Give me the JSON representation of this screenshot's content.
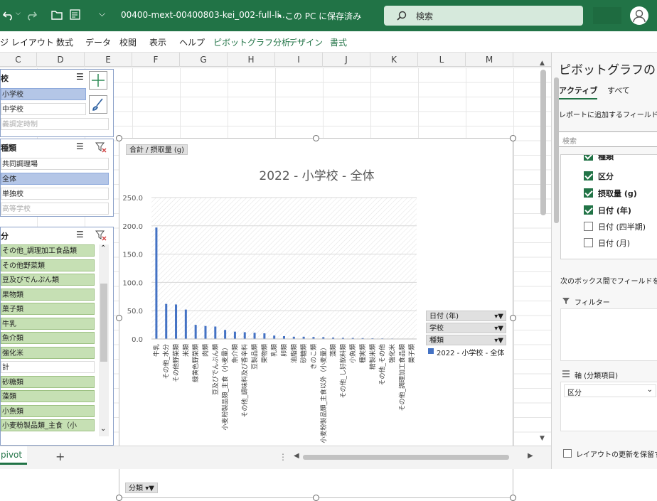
{
  "titlebar": {
    "undo_icon": "undo-icon",
    "filename": "00400-mext-00400803-kei_002-full-li…",
    "save_status": "• この PC に保存済み",
    "search_placeholder": "検索"
  },
  "menu": [
    "ジ レイアウト",
    "数式",
    "データ",
    "校閲",
    "表示",
    "ヘルプ",
    "ピボットグラフ分析",
    "デザイン",
    "書式"
  ],
  "columns": [
    "C",
    "D",
    "E",
    "F",
    "G",
    "H",
    "I",
    "J",
    "K",
    "L",
    "M"
  ],
  "slicers": {
    "school": {
      "title": "校",
      "items": [
        "小学校",
        "中学校",
        "義調定時制"
      ]
    },
    "type": {
      "title": "種類",
      "items": [
        "共同調理場",
        "全体",
        "単独校",
        "高等学校"
      ]
    },
    "category": {
      "title": "分",
      "items": [
        "その他_調理加工食品類",
        "その他野菜類",
        "豆及びでんぷん類",
        "果物類",
        "菓子類",
        "牛乳",
        "魚介類",
        "強化米",
        "計",
        "砂糖類",
        "藻類",
        "小魚類",
        "小麦粉製品類_主食（小"
      ]
    }
  },
  "chart_data": {
    "type": "bar",
    "title": "2022 - 小学校 - 全体",
    "value_field_button": "合計 / 摂取量 (g)",
    "axis_field_button": "分類",
    "ylim": [
      0,
      250
    ],
    "yticks": [
      "250.0",
      "200.0",
      "150.0",
      "100.0",
      "50.0",
      "0.0"
    ],
    "categories": [
      "牛乳",
      "その他_水分",
      "その他野菜類",
      "米類",
      "緑黄色野菜類",
      "肉類",
      "豆及びでんぷん類",
      "小麦粉製品類_主食（小麦量）",
      "魚介類",
      "その他_調味料及び香辛料",
      "豆製品類",
      "果物類",
      "乳類",
      "卵類",
      "油脂類",
      "砂糖類",
      "きのこ類",
      "小麦粉製品類_主食以外（小麦量）",
      "藻類",
      "その他_し好飲料類",
      "小魚類",
      "種実類",
      "精製米類",
      "その他_その他",
      "強化米",
      "その他_調理加工食品類",
      "菓子類"
    ],
    "series": [
      {
        "name": "2022 - 小学校 - 全体",
        "color": "#4472c4",
        "values": [
          197,
          62,
          61,
          52,
          25,
          23,
          22,
          16,
          13,
          12,
          11,
          10,
          6,
          5,
          4,
          4,
          3.5,
          3.2,
          2.5,
          2,
          1.8,
          1.5,
          1.2,
          1,
          0.8,
          0.6,
          0.5
        ]
      }
    ],
    "filter_buttons": [
      "日付 (年)",
      "学校",
      "種類"
    ]
  },
  "pane": {
    "title": "ピボットグラフのフィ",
    "tab_active": "アクティブ",
    "tab_all": "すべて",
    "instruction": "レポートに追加するフィールドを選",
    "search_placeholder": "検索",
    "fields": [
      {
        "label": "種類",
        "checked": true
      },
      {
        "label": "区分",
        "checked": true
      },
      {
        "label": "摂取量 (g)",
        "checked": true
      },
      {
        "label": "日付 (年)",
        "checked": true
      },
      {
        "label": "日付 (四半期)",
        "checked": false
      },
      {
        "label": "日付 (月)",
        "checked": false
      }
    ],
    "drag_hint": "次のボックス間でフィールドをドラ",
    "filter_label": "フィルター",
    "axis_label": "軸 (分類項目)",
    "axis_value": "区分",
    "defer_label": "レイアウトの更新を保留す"
  },
  "sheet": {
    "tab": "pivot",
    "add": "+"
  }
}
